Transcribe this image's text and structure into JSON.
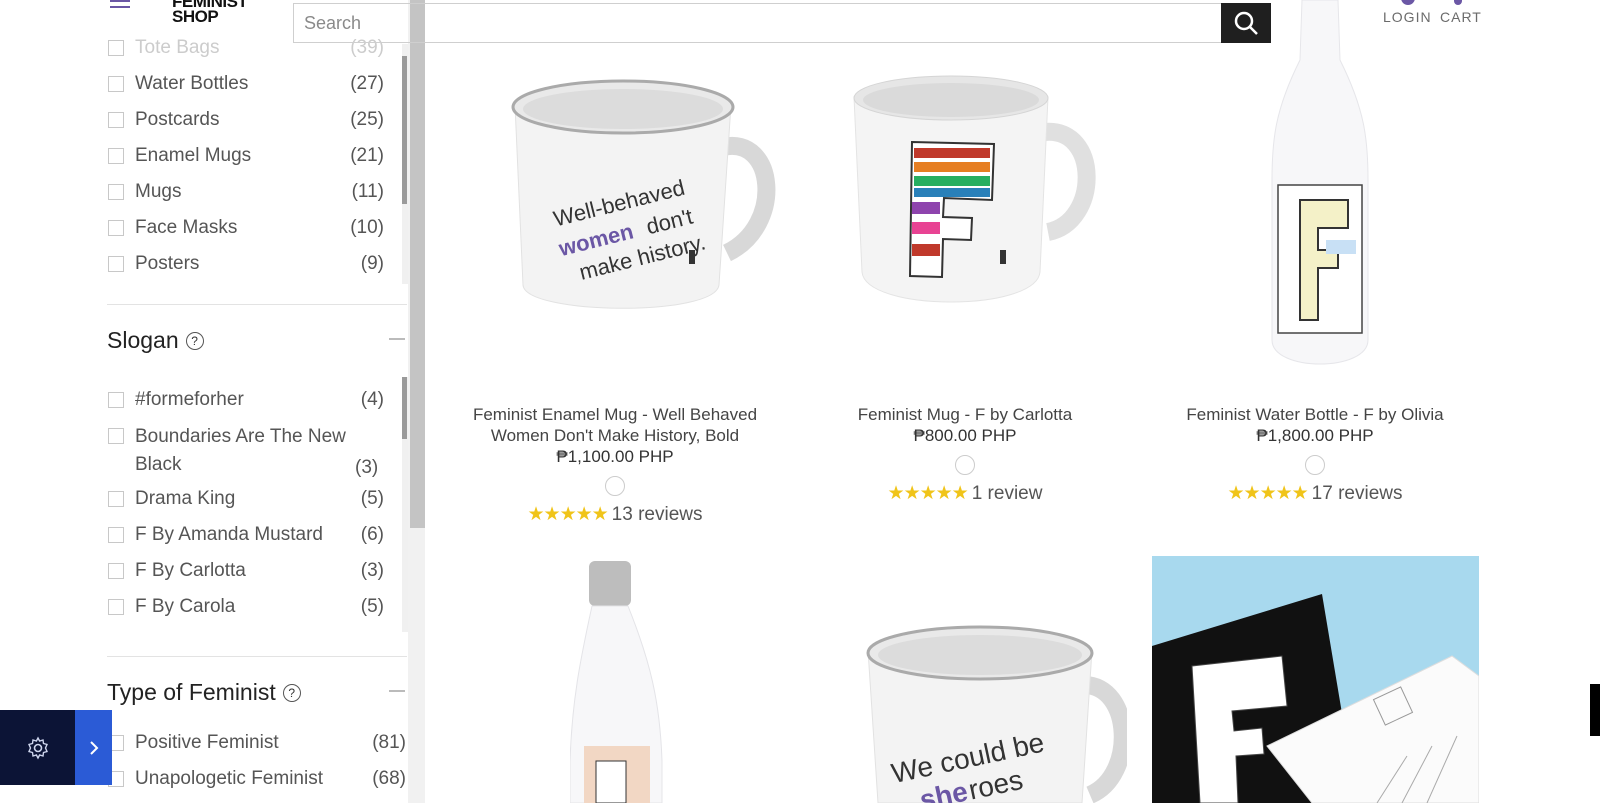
{
  "header": {
    "logo_line1": "FEMINIST",
    "logo_line2": "SHOP",
    "search_placeholder": "Search",
    "login": "LOGIN",
    "cart": "CART"
  },
  "sidebar": {
    "type_items": [
      {
        "label": "Tote Bags",
        "count": "(39)"
      },
      {
        "label": "Water Bottles",
        "count": "(27)"
      },
      {
        "label": "Postcards",
        "count": "(25)"
      },
      {
        "label": "Enamel Mugs",
        "count": "(21)"
      },
      {
        "label": "Mugs",
        "count": "(11)"
      },
      {
        "label": "Face Masks",
        "count": "(10)"
      },
      {
        "label": "Posters",
        "count": "(9)"
      }
    ],
    "slogan_title": "Slogan",
    "slogan_items": [
      {
        "label": "#formeforher",
        "count": "(4)"
      },
      {
        "label": "Boundaries Are The New Black",
        "count": "(3)"
      },
      {
        "label": "Drama King",
        "count": "(5)"
      },
      {
        "label": "F By Amanda Mustard",
        "count": "(6)"
      },
      {
        "label": "F By Carlotta",
        "count": "(3)"
      },
      {
        "label": "F By Carola",
        "count": "(5)"
      }
    ],
    "feminist_title": "Type of Feminist",
    "feminist_items": [
      {
        "label": "Positive Feminist",
        "count": "(81)"
      },
      {
        "label": "Unapologetic Feminist",
        "count": "(68)"
      }
    ],
    "help_symbol": "?"
  },
  "products": [
    {
      "title_line1": "Feminist Enamel Mug - Well Behaved",
      "title_line2": "Women Don't Make History, Bold",
      "price": "₱1,100.00 PHP",
      "stars": "★★★★★",
      "reviews": "13 reviews",
      "mug_text1": "Well-behaved",
      "mug_text2": "women",
      "mug_text3": "don't",
      "mug_text4": "make history."
    },
    {
      "title_line1": "Feminist Mug - F by Carlotta",
      "price": "₱800.00 PHP",
      "stars": "★★★★★",
      "reviews": "1 review"
    },
    {
      "title_line1": "Feminist Water Bottle - F by Olivia",
      "price": "₱1,800.00 PHP",
      "stars": "★★★★★",
      "reviews": "17 reviews"
    }
  ],
  "row2": {
    "mug_text1": "We could be",
    "mug_text2": "she",
    "mug_text3": "roes"
  },
  "colors": {
    "accent_purple": "#6b57a5",
    "star_yellow": "#f0c419",
    "settings_navy": "#0c1436",
    "settings_blue": "#2b5bd6"
  }
}
